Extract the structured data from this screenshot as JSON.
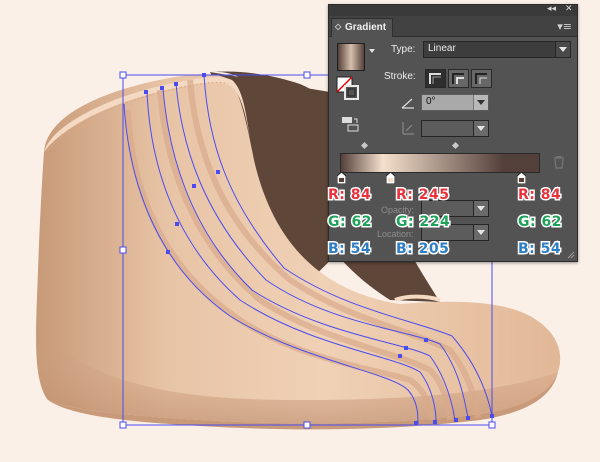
{
  "panel": {
    "tab_title": "Gradient",
    "type_label": "Type:",
    "type_value": "Linear",
    "stroke_label": "Stroke:",
    "angle_value": "0°",
    "opacity_label": "Opacity:",
    "location_label": "Location:",
    "stops": [
      {
        "r_label": "R: 84",
        "g_label": "G: 62",
        "b_label": "B: 54"
      },
      {
        "r_label": "R: 245",
        "g_label": "G: 224",
        "b_label": "B: 205"
      },
      {
        "r_label": "R: 84",
        "g_label": "G: 62",
        "b_label": "B: 54"
      }
    ]
  },
  "icons": {
    "collapse": "double-left-chevron-icon",
    "close": "close-x-icon",
    "menu": "panel-menu-icon"
  },
  "colors": {
    "stop_dark": "#543e36",
    "stop_light": "#f5e0cd",
    "selection": "#4a4cf0",
    "boot_skin": "#e7c0a0"
  }
}
